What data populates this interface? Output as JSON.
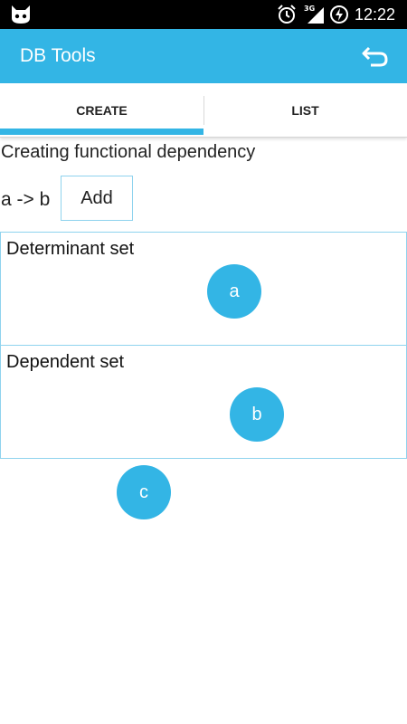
{
  "status_bar": {
    "time": "12:22",
    "network": "3G",
    "icons": [
      "cyanogen-cat-icon",
      "alarm-icon",
      "signal-icon",
      "battery-charging-icon"
    ]
  },
  "app_bar": {
    "title": "DB Tools",
    "back_icon": "undo-arrow-icon",
    "background": "#33b5e5"
  },
  "tabs": [
    {
      "label": "CREATE",
      "selected": true
    },
    {
      "label": "LIST",
      "selected": false
    }
  ],
  "content": {
    "heading": "Creating functional dependency",
    "fd_expression": "a -> b",
    "add_label": "Add",
    "determinant_label": "Determinant set",
    "dependent_label": "Dependent set",
    "nodes": {
      "a": "a",
      "b": "b",
      "c": "c"
    }
  },
  "colors": {
    "accent": "#33b5e5",
    "box_border": "#8fd3ee"
  }
}
